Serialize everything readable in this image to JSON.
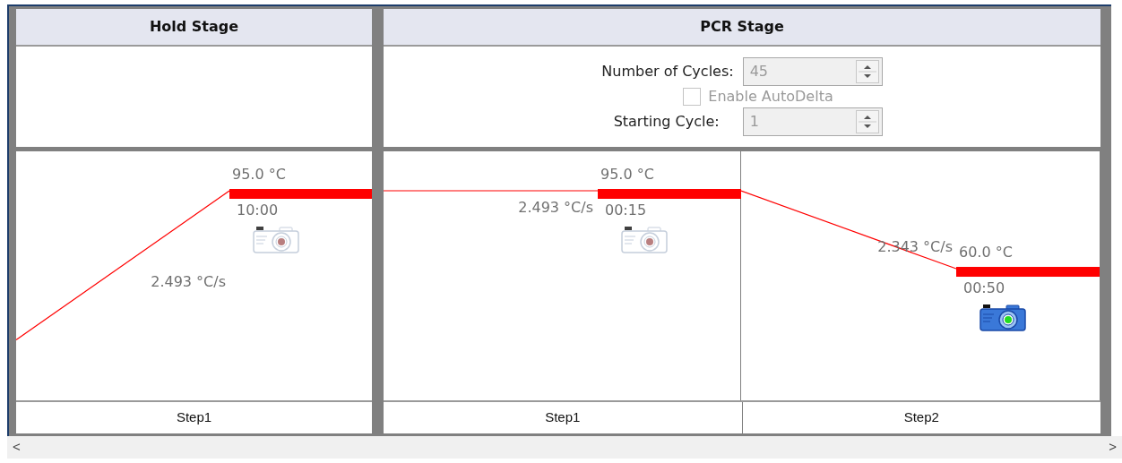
{
  "stages": [
    {
      "title": "Hold Stage",
      "steps": [
        {
          "label": "Step1",
          "temperature": "95.0 °C",
          "time": "10:00",
          "ramp_rate": "2.493 °C/s",
          "data_collection": false
        }
      ]
    },
    {
      "title": "PCR Stage",
      "cycles": {
        "label": "Number of Cycles:",
        "value": "45",
        "disabled": true
      },
      "auto_delta": {
        "label": "Enable AutoDelta",
        "checked": false,
        "disabled": true
      },
      "starting_cycle": {
        "label": "Starting Cycle:",
        "value": "1",
        "disabled": true
      },
      "steps": [
        {
          "label": "Step1",
          "temperature": "95.0 °C",
          "time": "00:15",
          "ramp_rate": "2.493 °C/s",
          "data_collection": false
        },
        {
          "label": "Step2",
          "temperature": "60.0 °C",
          "time": "00:50",
          "ramp_rate": "2.343 °C/s",
          "data_collection": true
        }
      ]
    }
  ],
  "scrollbar": {
    "left": "<",
    "right": ">"
  }
}
